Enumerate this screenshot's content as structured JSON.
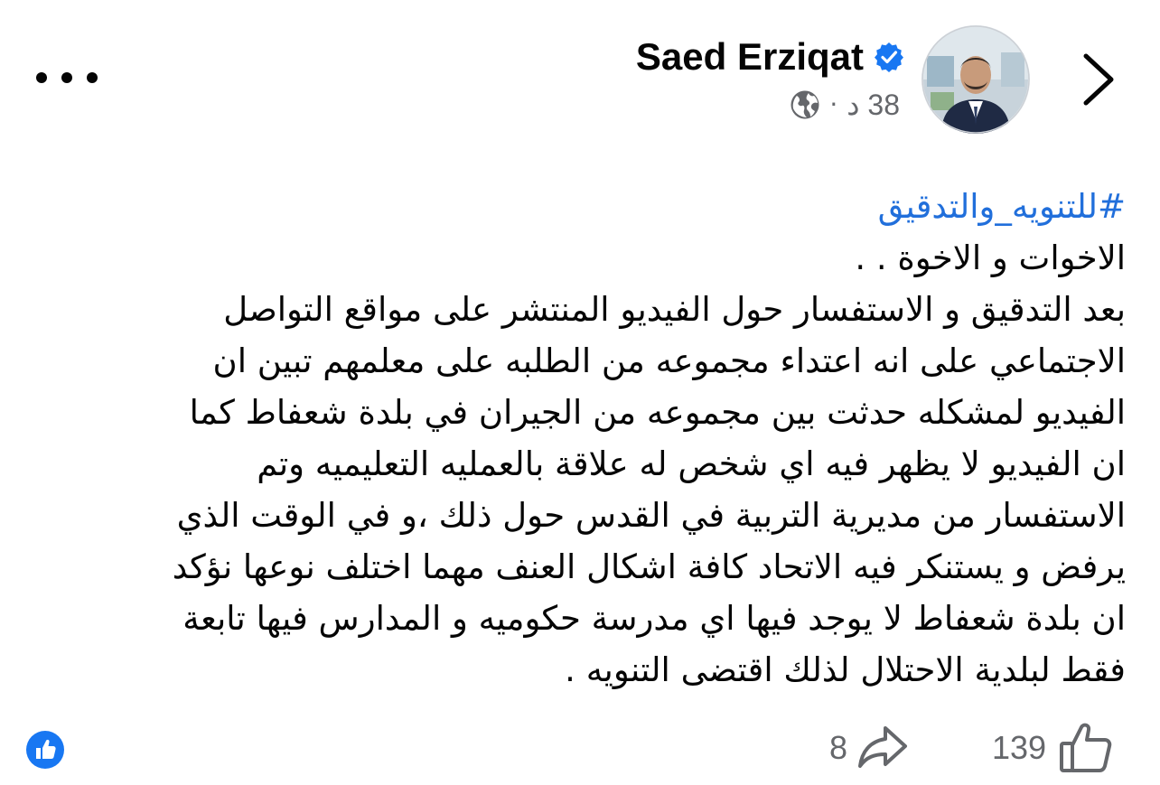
{
  "header": {
    "author_name": "Saed Erziqat",
    "time": "38 د",
    "separator": "·",
    "more_icon": "more-horizontal-icon",
    "back_icon": "chevron-right-icon",
    "verified_icon": "verified-badge-icon",
    "privacy_icon": "globe-icon"
  },
  "post": {
    "hashtag": "#للتنويه_والتدقيق",
    "lines": [
      "الاخوات و الاخوة . .",
      "بعد التدقيق و الاستفسار حول الفيديو المنتشر على مواقع التواصل",
      "الاجتماعي على انه اعتداء مجموعه من الطلبه على معلمهم تبين ان",
      "الفيديو لمشكله حدثت بين مجموعه من الجيران في بلدة شعفاط  كما",
      "ان الفيديو لا يظهر فيه اي شخص له علاقة بالعمليه التعليميه وتم",
      "الاستفسار من مديرية التربية في القدس حول ذلك ،و في الوقت الذي",
      "يرفض و يستنكر فيه الاتحاد كافة اشكال العنف مهما اختلف نوعها نؤكد",
      "ان بلدة شعفاط لا يوجد فيها اي مدرسة حكوميه و المدارس فيها تابعة",
      "فقط لبلدية الاحتلال لذلك اقتضى التنويه ."
    ]
  },
  "footer": {
    "likes_count": "139",
    "shares_count": "8",
    "like_icon": "thumbs-up-icon",
    "share_icon": "share-arrow-icon",
    "reaction_icon": "like-reaction-badge-icon"
  },
  "colors": {
    "link_blue": "#216fdb",
    "verified_blue": "#1877f2",
    "muted_gray": "#65676b"
  }
}
